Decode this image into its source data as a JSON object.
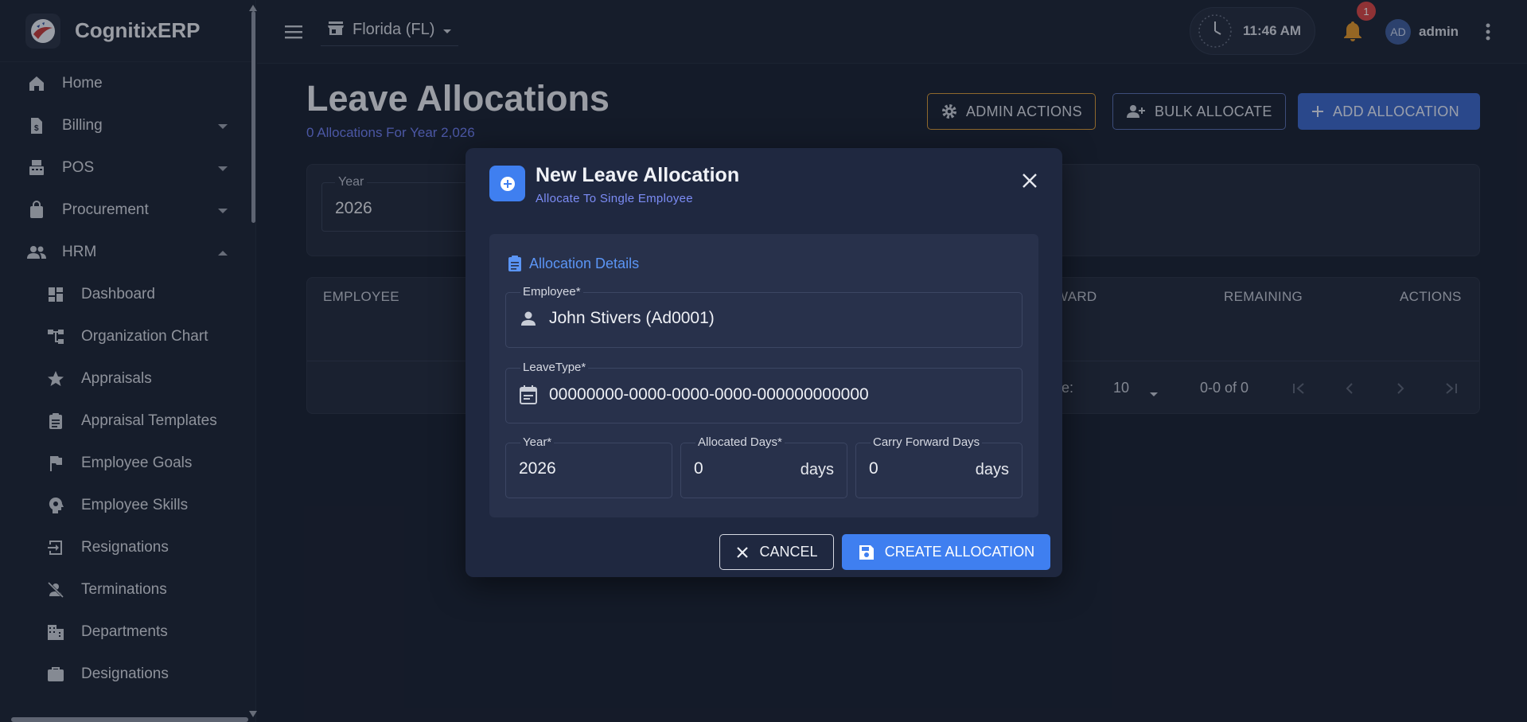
{
  "app": {
    "name": "CognitixERP"
  },
  "sidebar": {
    "items": [
      {
        "label": "Home",
        "icon": "home-icon"
      },
      {
        "label": "Billing",
        "icon": "billing-icon"
      },
      {
        "label": "POS",
        "icon": "pos-icon"
      },
      {
        "label": "Procurement",
        "icon": "bag-icon"
      },
      {
        "label": "HRM",
        "icon": "people-icon"
      }
    ],
    "sub_items": [
      {
        "label": "Dashboard",
        "icon": "dashboard-icon"
      },
      {
        "label": "Organization Chart",
        "icon": "org-chart-icon"
      },
      {
        "label": "Appraisals",
        "icon": "star-icon"
      },
      {
        "label": "Appraisal Templates",
        "icon": "clipboard-icon"
      },
      {
        "label": "Employee Goals",
        "icon": "flag-icon"
      },
      {
        "label": "Employee Skills",
        "icon": "head-icon"
      },
      {
        "label": "Resignations",
        "icon": "exit-icon"
      },
      {
        "label": "Terminations",
        "icon": "person-off-icon"
      },
      {
        "label": "Departments",
        "icon": "building-icon"
      },
      {
        "label": "Designations",
        "icon": "briefcase-icon"
      }
    ]
  },
  "topbar": {
    "store": "Florida (FL)",
    "time": "11:46 AM",
    "notifications_count": "1",
    "avatar_initials": "AD",
    "user": "admin"
  },
  "page": {
    "title": "Leave Allocations",
    "subtitle": "0 Allocations For Year 2,026",
    "buttons": {
      "admin": "ADMIN ACTIONS",
      "bulk": "BULK ALLOCATE",
      "add": "ADD ALLOCATION"
    },
    "filter": {
      "year_label": "Year",
      "year_value": "2026"
    },
    "table": {
      "columns": {
        "employee": "EMPLOYEE",
        "forward": "WARD",
        "remaining": "REMAINING",
        "actions": "ACTIONS"
      },
      "rows_label": "ge:",
      "rows_value": "10",
      "range": "0-0 of 0"
    }
  },
  "modal": {
    "title": "New Leave Allocation",
    "subtitle": "Allocate To Single Employee",
    "section_title": "Allocation Details",
    "employee": {
      "label": "Employee*",
      "value": "John Stivers (Ad0001)"
    },
    "leave_type": {
      "label": "LeaveType*",
      "value": "00000000-0000-0000-0000-000000000000"
    },
    "year": {
      "label": "Year*",
      "value": "2026"
    },
    "allocated": {
      "label": "Allocated Days*",
      "value": "0",
      "suffix": "days"
    },
    "carry": {
      "label": "Carry Forward Days",
      "value": "0",
      "suffix": "days"
    },
    "cancel": "CANCEL",
    "create": "CREATE ALLOCATION"
  },
  "colors": {
    "primary": "#3f7ff0",
    "accent_text": "#7c8cf5",
    "warning_border": "#d79a3a",
    "badge": "#d84545",
    "background": "#1b2233"
  }
}
